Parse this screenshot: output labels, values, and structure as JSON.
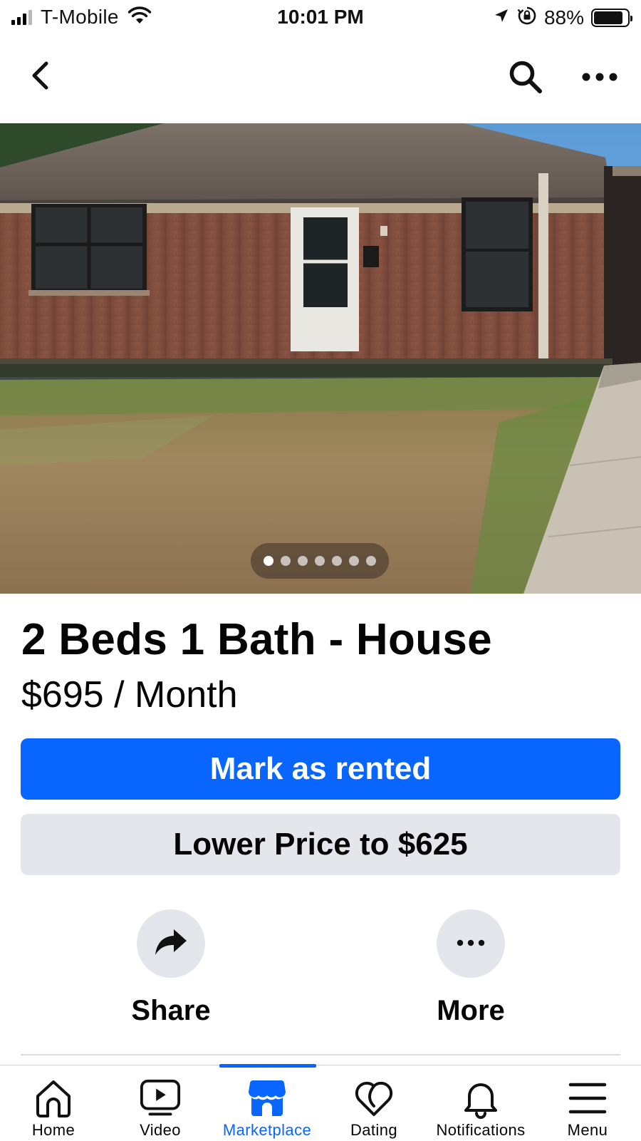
{
  "status_bar": {
    "carrier": "T-Mobile",
    "time": "10:01 PM",
    "battery_percent": "88%",
    "battery_level": 0.88,
    "signal_bars": 3,
    "icons": [
      "signal-icon",
      "wifi-icon",
      "location-icon",
      "orientation-lock-icon",
      "battery-icon"
    ]
  },
  "nav": {
    "icons": [
      "back-icon",
      "search-icon",
      "more-icon"
    ]
  },
  "photo": {
    "total_images": 7,
    "current_image": 1
  },
  "listing": {
    "title": "2 Beds 1 Bath - House",
    "price": "$695 / Month"
  },
  "buttons": {
    "mark_rented": "Mark as rented",
    "lower_price": "Lower Price to $625"
  },
  "actions": [
    {
      "label": "Share",
      "icon": "share-icon"
    },
    {
      "label": "More",
      "icon": "more-dots-icon"
    }
  ],
  "tabs": [
    {
      "label": "Home",
      "icon": "home-icon",
      "active": false
    },
    {
      "label": "Video",
      "icon": "video-icon",
      "active": false
    },
    {
      "label": "Marketplace",
      "icon": "marketplace-icon",
      "active": true
    },
    {
      "label": "Dating",
      "icon": "dating-icon",
      "active": false
    },
    {
      "label": "Notifications",
      "icon": "bell-icon",
      "active": false
    },
    {
      "label": "Menu",
      "icon": "menu-icon",
      "active": false
    }
  ],
  "colors": {
    "accent": "#0866ff",
    "secondary_button": "#e4e6eb",
    "text": "#050505"
  }
}
